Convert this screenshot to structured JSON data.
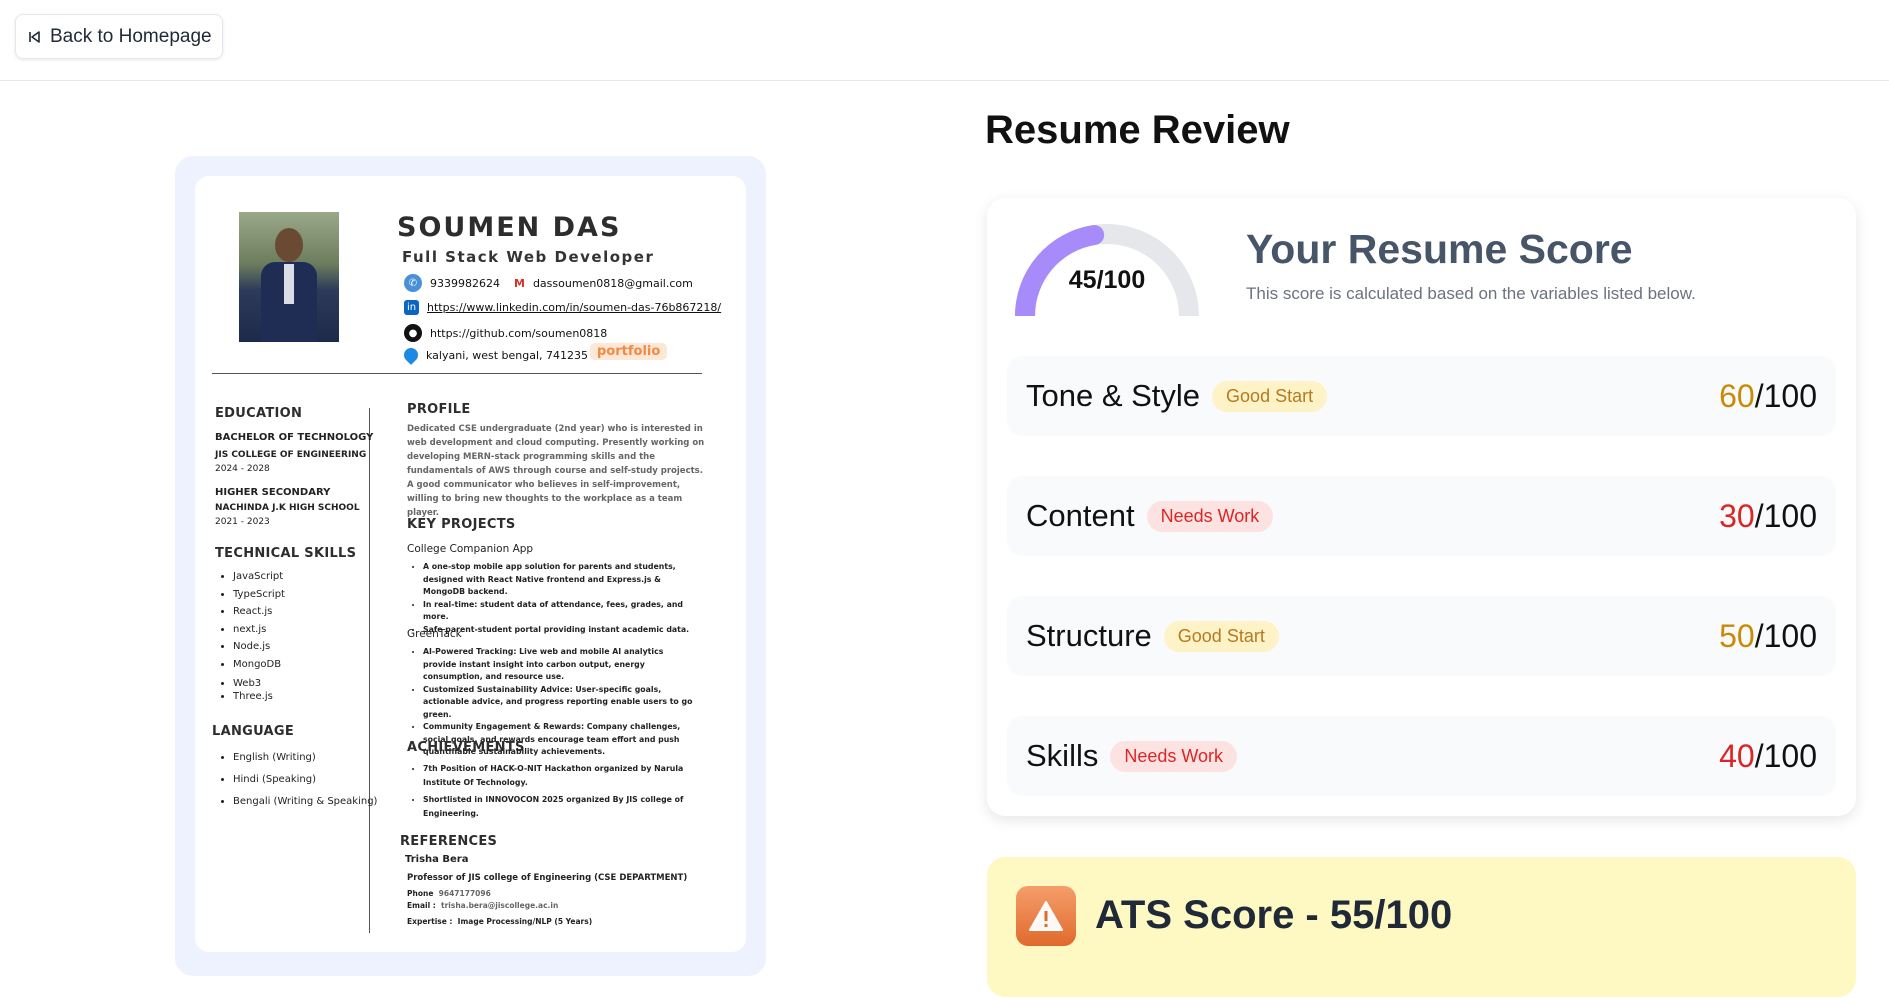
{
  "topbar": {
    "back_label": "Back to Homepage"
  },
  "resume": {
    "name": "SOUMEN DAS",
    "role": "Full Stack Web Developer",
    "phone": "9339982624",
    "email": "dassoumen0818@gmail.com",
    "linkedin": "https://www.linkedin.com/in/soumen-das-76b867218/",
    "github": "https://github.com/soumen0818",
    "location": "kalyani, west bengal, 741235",
    "portfolio": "portfolio",
    "education": {
      "heading": "EDUCATION",
      "degree1": "BACHELOR OF TECHNOLOGY",
      "school1": "JIS COLLEGE OF ENGINEERING",
      "years1": "2024 - 2028",
      "degree2": "HIGHER SECONDARY",
      "school2": "NACHINDA J.K HIGH SCHOOL",
      "years2": "2021 - 2023"
    },
    "skills": {
      "heading": "TECHNICAL SKILLS",
      "items": [
        "JavaScript",
        "TypeScript",
        "React.js",
        "next.js",
        "Node.js",
        "MongoDB",
        "Web3",
        "Three.js"
      ]
    },
    "language": {
      "heading": "LANGUAGE",
      "items": [
        "English (Writing)",
        "Hindi (Speaking)",
        "Bengali (Writing & Speaking)"
      ]
    },
    "profile": {
      "heading": "PROFILE",
      "text": "Dedicated CSE undergraduate (2nd year) who is interested in web development and cloud computing. Presently working on developing MERN-stack programming skills and the fundamentals of AWS through course and self-study projects. A good communicator who believes in self-improvement, willing to bring new thoughts to the workplace as a team player."
    },
    "projects": {
      "heading": "KEY PROJECTS",
      "p1_title": "College Companion App",
      "p1_items": [
        "A one-stop mobile app solution for parents and students, designed with React Native frontend and Express.js & MongoDB backend.",
        "In real-time: student data of attendance, fees, grades, and more.",
        "Safe parent-student portal providing instant academic data."
      ],
      "p2_title": "GreenTack",
      "p2_items": [
        "AI-Powered Tracking: Live web and mobile AI analytics provide instant insight into carbon output, energy consumption, and resource use.",
        "Customized Sustainability Advice: User-specific goals, actionable advice, and progress reporting enable users to go green.",
        "Community Engagement & Rewards: Company challenges, social goals, and rewards encourage team effort and push quantifiable sustainability achievements."
      ]
    },
    "achievements": {
      "heading": "ACHIEVEMENTS",
      "items": [
        "7th Position of HACK-O-NIT Hackathon organized by Narula Institute Of Technology.",
        "Shortlisted in INNOVOCON 2025 organized By JIS college of Engineering."
      ]
    },
    "references": {
      "heading": "REFERENCES",
      "name": "Trisha Bera",
      "role": "Professor of JIS college of Engineering (CSE DEPARTMENT)",
      "phone_label": "Phone",
      "phone": "9647177096",
      "email_label": "Email :",
      "email": "trisha.bera@jiscollege.ac.in",
      "expertise_label": "Expertise :",
      "expertise": "Image Processing/NLP (5 Years)"
    }
  },
  "review": {
    "title": "Resume Review",
    "overall_score": 45,
    "overall_label": "45/100",
    "score_title": "Your Resume Score",
    "score_sub": "This score is calculated based on the variables listed below.",
    "categories": [
      {
        "name": "Tone & Style",
        "badge": "Good Start",
        "score": "60",
        "max": "/100"
      },
      {
        "name": "Content",
        "badge": "Needs Work",
        "score": "30",
        "max": "/100"
      },
      {
        "name": "Structure",
        "badge": "Good Start",
        "score": "50",
        "max": "/100"
      },
      {
        "name": "Skills",
        "badge": "Needs Work",
        "score": "40",
        "max": "/100"
      }
    ]
  },
  "ats": {
    "title": "ATS Score - 55/100"
  },
  "colors": {
    "good": "#ca8a04",
    "bad": "#dc2626",
    "gauge_fill": "#a78bfa",
    "gauge_track": "#e5e7eb"
  }
}
